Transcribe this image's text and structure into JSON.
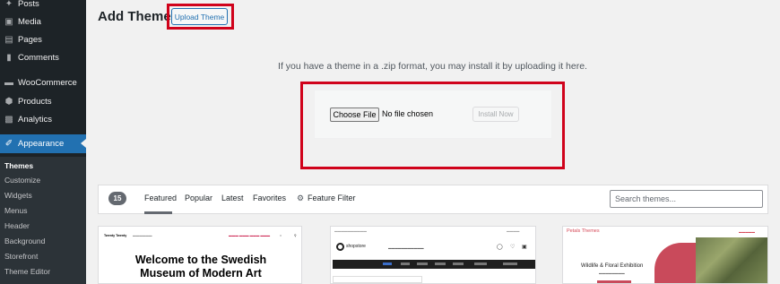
{
  "sidebar": {
    "items": [
      {
        "label": "Posts",
        "icon": "pin-icon"
      },
      {
        "label": "Media",
        "icon": "media-icon"
      },
      {
        "label": "Pages",
        "icon": "pages-icon"
      },
      {
        "label": "Comments",
        "icon": "comments-icon"
      },
      {
        "label": "WooCommerce",
        "icon": "woocommerce-icon"
      },
      {
        "label": "Products",
        "icon": "products-icon"
      },
      {
        "label": "Analytics",
        "icon": "analytics-icon"
      },
      {
        "label": "Appearance",
        "icon": "brush-icon"
      }
    ],
    "submenu": [
      "Themes",
      "Customize",
      "Widgets",
      "Menus",
      "Header",
      "Background",
      "Storefront",
      "Theme Editor"
    ]
  },
  "header": {
    "title": "Add Themes",
    "upload_button": "Upload Theme"
  },
  "upload": {
    "instruction": "If you have a theme in a .zip format, you may install it by uploading it here.",
    "choose_file": "Choose File",
    "file_status": "No file chosen",
    "install_now": "Install Now"
  },
  "filter": {
    "count": "15",
    "tabs": [
      "Featured",
      "Popular",
      "Latest",
      "Favorites"
    ],
    "feature_filter": "Feature Filter",
    "search_placeholder": "Search themes..."
  },
  "cards": {
    "card1": {
      "brand": "Twenty Twenty",
      "heading_line1": "Welcome to the Swedish",
      "heading_line2": "Museum of Modern Art"
    },
    "card2": {
      "brand": "shopstore"
    },
    "card3": {
      "brand": "Petals Themes",
      "title": "Wildlife & Floral Exhibition"
    }
  },
  "colors": {
    "sidebar_bg": "#1d2327",
    "accent": "#2271b1",
    "highlight": "#d0021b"
  }
}
